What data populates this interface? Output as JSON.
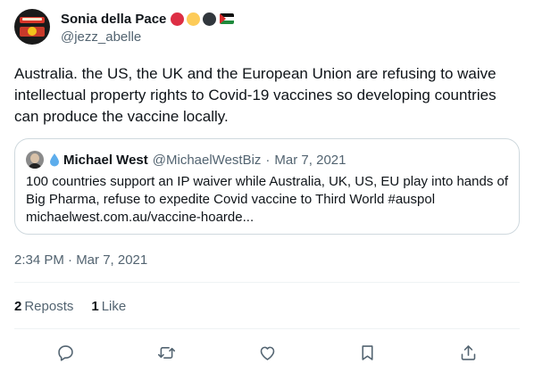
{
  "author": {
    "name": "Sonia della Pace",
    "handle": "@jezz_abelle",
    "emoji_badges": [
      "red-circle",
      "yellow-circle",
      "black-circle",
      "palestine-flag"
    ]
  },
  "tweet": {
    "text": "Australia. the US, the UK and the European Union are refusing to waive intellectual property rights to Covid-19 vaccines so developing countries can produce the vaccine locally."
  },
  "quoted": {
    "name": "Michael West",
    "handle": "@MichaelWestBiz",
    "separator": "·",
    "date": "Mar 7, 2021",
    "text": "100 countries support an IP waiver while Australia, UK, US, EU play into hands of Big Pharma, refuse to expedite Covid vaccine to Third World #auspol michaelwest.com.au/vaccine-hoarde..."
  },
  "timestamp": "2:34 PM · Mar 7, 2021",
  "stats": {
    "reposts_count": "2",
    "reposts_label": "Reposts",
    "likes_count": "1",
    "likes_label": "Like"
  },
  "actions": [
    "reply-icon",
    "repost-icon",
    "like-icon",
    "bookmark-icon",
    "share-icon"
  ],
  "colors": {
    "text": "#0f1419",
    "secondary": "#536471",
    "border": "#cfd9de",
    "divider": "#eff3f4"
  }
}
